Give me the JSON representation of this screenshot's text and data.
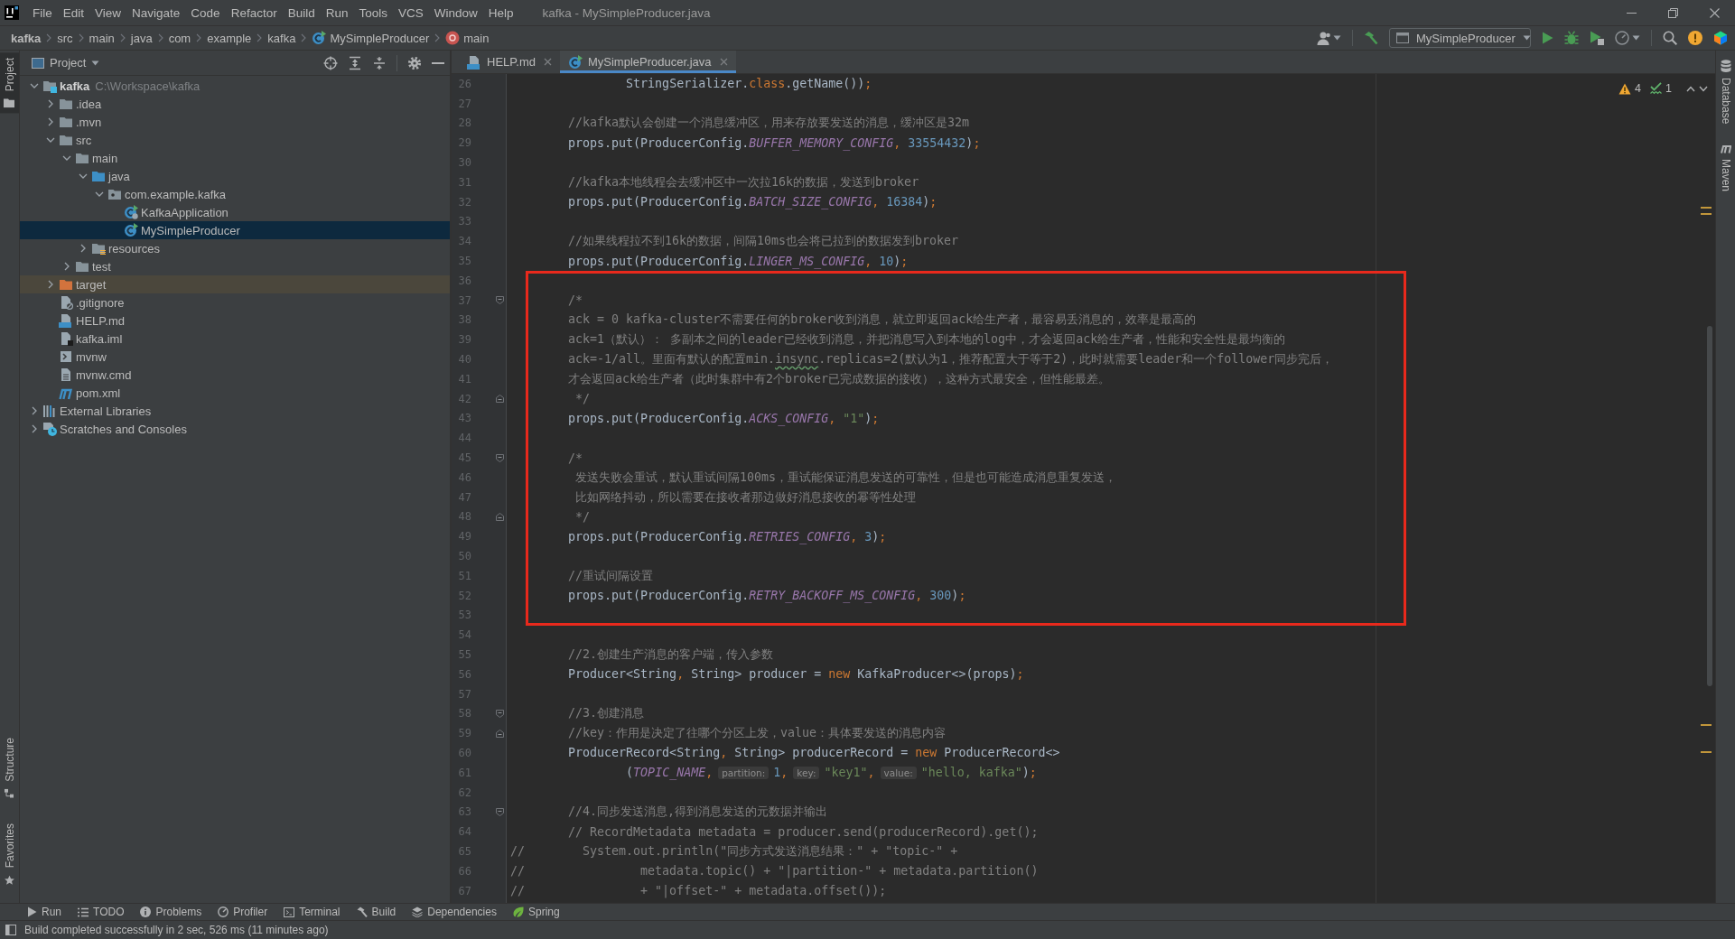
{
  "window": {
    "title": "kafka - MySimpleProducer.java"
  },
  "menu": [
    "File",
    "Edit",
    "View",
    "Navigate",
    "Code",
    "Refactor",
    "Build",
    "Run",
    "Tools",
    "VCS",
    "Window",
    "Help"
  ],
  "breadcrumb": [
    {
      "kind": "module",
      "label": "kafka"
    },
    {
      "kind": "folder",
      "label": "src"
    },
    {
      "kind": "folder",
      "label": "main"
    },
    {
      "kind": "folder",
      "label": "java"
    },
    {
      "kind": "folder",
      "label": "com"
    },
    {
      "kind": "folder",
      "label": "example"
    },
    {
      "kind": "folder",
      "label": "kafka"
    },
    {
      "kind": "class",
      "label": "MySimpleProducer"
    },
    {
      "kind": "method",
      "label": "main"
    }
  ],
  "run_config": {
    "label": "MySimpleProducer"
  },
  "left_strip": {
    "top": [
      {
        "kind": "project",
        "label": "Project",
        "selected": true
      }
    ],
    "bottom": [
      {
        "kind": "structure",
        "label": "Structure",
        "selected": false
      },
      {
        "kind": "favorites",
        "label": "Favorites",
        "selected": false
      }
    ]
  },
  "right_strip": [
    {
      "kind": "database",
      "label": "Database",
      "selected": false
    },
    {
      "kind": "maven",
      "label": "Maven",
      "selected": false
    }
  ],
  "project_panel": {
    "title": "Project",
    "tree": [
      {
        "kind": "module",
        "label": "kafka",
        "path": "C:\\Workspace\\kafka",
        "expanded": true,
        "selected": false,
        "children": [
          {
            "kind": "folder",
            "label": ".idea",
            "expanded": false,
            "selected": false
          },
          {
            "kind": "folder",
            "label": ".mvn",
            "expanded": false,
            "selected": false
          },
          {
            "kind": "folder",
            "label": "src",
            "expanded": true,
            "selected": false,
            "children": [
              {
                "kind": "folder",
                "label": "main",
                "expanded": true,
                "selected": false,
                "children": [
                  {
                    "kind": "source",
                    "label": "java",
                    "expanded": true,
                    "selected": false,
                    "children": [
                      {
                        "kind": "package",
                        "label": "com.example.kafka",
                        "expanded": true,
                        "selected": false,
                        "children": [
                          {
                            "kind": "spring",
                            "label": "KafkaApplication",
                            "selected": false
                          },
                          {
                            "kind": "class",
                            "label": "MySimpleProducer",
                            "selected": true
                          }
                        ]
                      }
                    ]
                  },
                  {
                    "kind": "resources",
                    "label": "resources",
                    "expanded": false,
                    "selected": false
                  }
                ]
              },
              {
                "kind": "folder",
                "label": "test",
                "expanded": false,
                "selected": false
              }
            ]
          },
          {
            "kind": "excluded",
            "label": "target",
            "expanded": false,
            "selected": false
          },
          {
            "kind": "gitignore",
            "label": ".gitignore",
            "selected": false
          },
          {
            "kind": "markdown",
            "label": "HELP.md",
            "selected": false
          },
          {
            "kind": "iml",
            "label": "kafka.iml",
            "selected": false
          },
          {
            "kind": "script",
            "label": "mvnw",
            "selected": false
          },
          {
            "kind": "cmd",
            "label": "mvnw.cmd",
            "selected": false
          },
          {
            "kind": "maven",
            "label": "pom.xml",
            "selected": false
          }
        ]
      },
      {
        "kind": "libraries",
        "label": "External Libraries",
        "expanded": false,
        "selected": false
      },
      {
        "kind": "scratches",
        "label": "Scratches and Consoles",
        "expanded": false,
        "selected": false
      }
    ]
  },
  "editor": {
    "tabs": [
      {
        "kind": "markdown",
        "label": "HELP.md",
        "selected": false
      },
      {
        "kind": "class",
        "label": "MySimpleProducer.java",
        "selected": true
      }
    ],
    "inspections": {
      "warnings": "4",
      "typos": "1"
    },
    "blocks": [
      {
        "highlighted": false,
        "lines": [
          {
            "number": "26",
            "kind": "plain",
            "segments": [
              {
                "kind": "code",
                "text": "                StringSerializer."
              },
              {
                "kind": "keyword",
                "text": "class"
              },
              {
                "kind": "code",
                "text": ".getName())"
              },
              {
                "kind": "keyword",
                "text": ";"
              }
            ]
          },
          {
            "number": "27",
            "kind": "plain"
          },
          {
            "number": "28",
            "kind": "plain",
            "segments": [
              {
                "kind": "comment",
                "text": "        //kafka默认会创建一个消息缓冲区，用来存放要发送的消息，缓冲区是32m"
              }
            ]
          },
          {
            "number": "29",
            "kind": "plain",
            "segments": [
              {
                "kind": "code",
                "text": "        props.put(ProducerConfig."
              },
              {
                "kind": "constant",
                "text": "BUFFER_MEMORY_CONFIG"
              },
              {
                "kind": "keyword",
                "text": ", "
              },
              {
                "kind": "number",
                "text": "33554432"
              },
              {
                "kind": "code",
                "text": ")"
              },
              {
                "kind": "keyword",
                "text": ";"
              }
            ]
          },
          {
            "number": "30",
            "kind": "plain"
          },
          {
            "number": "31",
            "kind": "plain",
            "segments": [
              {
                "kind": "comment",
                "text": "        //kafka本地线程会去缓冲区中一次拉16k的数据，发送到broker"
              }
            ]
          },
          {
            "number": "32",
            "kind": "plain",
            "segments": [
              {
                "kind": "code",
                "text": "        props.put(ProducerConfig."
              },
              {
                "kind": "constant",
                "text": "BATCH_SIZE_CONFIG"
              },
              {
                "kind": "keyword",
                "text": ", "
              },
              {
                "kind": "number",
                "text": "16384"
              },
              {
                "kind": "code",
                "text": ")"
              },
              {
                "kind": "keyword",
                "text": ";"
              }
            ]
          },
          {
            "number": "33",
            "kind": "plain"
          },
          {
            "number": "34",
            "kind": "plain",
            "segments": [
              {
                "kind": "comment",
                "text": "        //如果线程拉不到16k的数据，间隔10ms也会将已拉到的数据发到broker"
              }
            ]
          },
          {
            "number": "35",
            "kind": "plain",
            "segments": [
              {
                "kind": "code",
                "text": "        props.put(ProducerConfig."
              },
              {
                "kind": "constant",
                "text": "LINGER_MS_CONFIG"
              },
              {
                "kind": "keyword",
                "text": ", "
              },
              {
                "kind": "number",
                "text": "10"
              },
              {
                "kind": "code",
                "text": ")"
              },
              {
                "kind": "keyword",
                "text": ";"
              }
            ]
          }
        ]
      },
      {
        "highlighted": true,
        "lines": [
          {
            "number": "36",
            "kind": "plain"
          },
          {
            "number": "37",
            "kind": "foldstart",
            "segments": [
              {
                "kind": "comment",
                "text": "        /*"
              }
            ]
          },
          {
            "number": "38",
            "kind": "plain",
            "segments": [
              {
                "kind": "comment",
                "text": "        ack = 0 kafka-cluster不需要任何的broker收到消息，就立即返回ack给生产者，最容易丢消息的，效率是最高的"
              }
            ]
          },
          {
            "number": "39",
            "kind": "plain",
            "segments": [
              {
                "kind": "comment",
                "text": "        ack=1（默认）： 多副本之间的leader已经收到消息，并把消息写入到本地的log中，才会返回ack给生产者，性能和安全性是最均衡的"
              }
            ]
          },
          {
            "number": "40",
            "kind": "plain",
            "segments": [
              {
                "kind": "comment",
                "text": "        ack=-1/all。里面有默认的配置min."
              },
              {
                "kind": "typo",
                "text": "insync"
              },
              {
                "kind": "comment",
                "text": ".replicas=2(默认为1，推荐配置大于等于2)，此时就需要leader和一个follower同步完后，"
              }
            ]
          },
          {
            "number": "41",
            "kind": "plain",
            "segments": [
              {
                "kind": "comment",
                "text": "        才会返回ack给生产者（此时集群中有2个broker已完成数据的接收），这种方式最安全，但性能最差。"
              }
            ]
          },
          {
            "number": "42",
            "kind": "foldend",
            "segments": [
              {
                "kind": "comment",
                "text": "         */"
              }
            ]
          },
          {
            "number": "43",
            "kind": "plain",
            "segments": [
              {
                "kind": "code",
                "text": "        props.put(ProducerConfig."
              },
              {
                "kind": "constant",
                "text": "ACKS_CONFIG"
              },
              {
                "kind": "keyword",
                "text": ", "
              },
              {
                "kind": "string",
                "text": "\"1\""
              },
              {
                "kind": "code",
                "text": ")"
              },
              {
                "kind": "keyword",
                "text": ";"
              }
            ]
          },
          {
            "number": "44",
            "kind": "plain"
          },
          {
            "number": "45",
            "kind": "foldstart",
            "segments": [
              {
                "kind": "comment",
                "text": "        /*"
              }
            ]
          },
          {
            "number": "46",
            "kind": "plain",
            "segments": [
              {
                "kind": "comment",
                "text": "         发送失败会重试，默认重试间隔100ms，重试能保证消息发送的可靠性，但是也可能造成消息重复发送，"
              }
            ]
          },
          {
            "number": "47",
            "kind": "plain",
            "segments": [
              {
                "kind": "comment",
                "text": "         比如网络抖动，所以需要在接收者那边做好消息接收的幂等性处理"
              }
            ]
          },
          {
            "number": "48",
            "kind": "foldend",
            "segments": [
              {
                "kind": "comment",
                "text": "         */"
              }
            ]
          },
          {
            "number": "49",
            "kind": "plain",
            "segments": [
              {
                "kind": "code",
                "text": "        props.put(ProducerConfig."
              },
              {
                "kind": "constant",
                "text": "RETRIES_CONFIG"
              },
              {
                "kind": "keyword",
                "text": ", "
              },
              {
                "kind": "number",
                "text": "3"
              },
              {
                "kind": "code",
                "text": ")"
              },
              {
                "kind": "keyword",
                "text": ";"
              }
            ]
          },
          {
            "number": "50",
            "kind": "plain"
          },
          {
            "number": "51",
            "kind": "plain",
            "segments": [
              {
                "kind": "comment",
                "text": "        //重试间隔设置"
              }
            ]
          },
          {
            "number": "52",
            "kind": "plain",
            "segments": [
              {
                "kind": "code",
                "text": "        props.put(ProducerConfig."
              },
              {
                "kind": "constant",
                "text": "RETRY_BACKOFF_MS_CONFIG"
              },
              {
                "kind": "keyword",
                "text": ", "
              },
              {
                "kind": "number",
                "text": "300"
              },
              {
                "kind": "code",
                "text": ")"
              },
              {
                "kind": "keyword",
                "text": ";"
              }
            ]
          },
          {
            "number": "53",
            "kind": "plain"
          }
        ]
      },
      {
        "highlighted": false,
        "lines": [
          {
            "number": "54",
            "kind": "plain"
          },
          {
            "number": "55",
            "kind": "plain",
            "segments": [
              {
                "kind": "comment",
                "text": "        //2.创建生产消息的客户端，传入参数"
              }
            ]
          },
          {
            "number": "56",
            "kind": "plain",
            "segments": [
              {
                "kind": "code",
                "text": "        Producer<String"
              },
              {
                "kind": "keyword",
                "text": ", "
              },
              {
                "kind": "code",
                "text": "String> producer = "
              },
              {
                "kind": "keyword",
                "text": "new"
              },
              {
                "kind": "code",
                "text": " KafkaProducer<>(props)"
              },
              {
                "kind": "keyword",
                "text": ";"
              }
            ]
          },
          {
            "number": "57",
            "kind": "plain"
          },
          {
            "number": "58",
            "kind": "foldstart",
            "segments": [
              {
                "kind": "comment",
                "text": "        //3.创建消息"
              }
            ]
          },
          {
            "number": "59",
            "kind": "foldend",
            "segments": [
              {
                "kind": "comment",
                "text": "        //key：作用是决定了往哪个分区上发，value：具体要发送的消息内容"
              }
            ]
          },
          {
            "number": "60",
            "kind": "plain",
            "segments": [
              {
                "kind": "code",
                "text": "        ProducerRecord<String"
              },
              {
                "kind": "keyword",
                "text": ", "
              },
              {
                "kind": "code",
                "text": "String> producerRecord = "
              },
              {
                "kind": "keyword",
                "text": "new"
              },
              {
                "kind": "code",
                "text": " ProducerRecord<>"
              }
            ]
          },
          {
            "number": "61",
            "kind": "plain",
            "segments": [
              {
                "kind": "code",
                "text": "                ("
              },
              {
                "kind": "constant",
                "text": "TOPIC_NAME"
              },
              {
                "kind": "keyword",
                "text": ","
              },
              {
                "kind": "hint",
                "text": "partition:"
              },
              {
                "kind": "number",
                "text": "1"
              },
              {
                "kind": "keyword",
                "text": ","
              },
              {
                "kind": "hint",
                "text": "key:"
              },
              {
                "kind": "string",
                "text": "\"key1\""
              },
              {
                "kind": "keyword",
                "text": ","
              },
              {
                "kind": "hint",
                "text": "value:"
              },
              {
                "kind": "string",
                "text": "\"hello, kafka\""
              },
              {
                "kind": "code",
                "text": ")"
              },
              {
                "kind": "keyword",
                "text": ";"
              }
            ]
          },
          {
            "number": "62",
            "kind": "plain"
          },
          {
            "number": "63",
            "kind": "foldstart",
            "segments": [
              {
                "kind": "comment",
                "text": "        //4.同步发送消息,得到消息发送的元数据并输出"
              }
            ]
          },
          {
            "number": "64",
            "kind": "plain",
            "segments": [
              {
                "kind": "comment",
                "text": "        // RecordMetadata metadata = producer.send(producerRecord).get();"
              }
            ]
          },
          {
            "number": "65",
            "kind": "plain",
            "segments": [
              {
                "kind": "comment",
                "text": "//        System.out.println(\"同步方式发送消息结果：\" + \"topic-\" +"
              }
            ]
          },
          {
            "number": "66",
            "kind": "plain",
            "segments": [
              {
                "kind": "comment",
                "text": "//                metadata.topic() + \"|partition-\" + metadata.partition()"
              }
            ]
          },
          {
            "number": "67",
            "kind": "plain",
            "segments": [
              {
                "kind": "comment",
                "text": "//                + \"|offset-\" + metadata.offset());"
              }
            ]
          }
        ]
      }
    ]
  },
  "bottom_tools": [
    {
      "kind": "run",
      "label": "Run",
      "selected": false
    },
    {
      "kind": "todo",
      "label": "TODO",
      "selected": false
    },
    {
      "kind": "problems",
      "label": "Problems",
      "selected": false
    },
    {
      "kind": "profiler",
      "label": "Profiler",
      "selected": false
    },
    {
      "kind": "terminal",
      "label": "Terminal",
      "selected": false
    },
    {
      "kind": "build",
      "label": "Build",
      "selected": false
    },
    {
      "kind": "dependencies",
      "label": "Dependencies",
      "selected": false
    },
    {
      "kind": "spring",
      "label": "Spring",
      "selected": false
    }
  ],
  "status_bar": {
    "message": "Build completed successfully in 2 sec, 526 ms (11 minutes ago)"
  }
}
